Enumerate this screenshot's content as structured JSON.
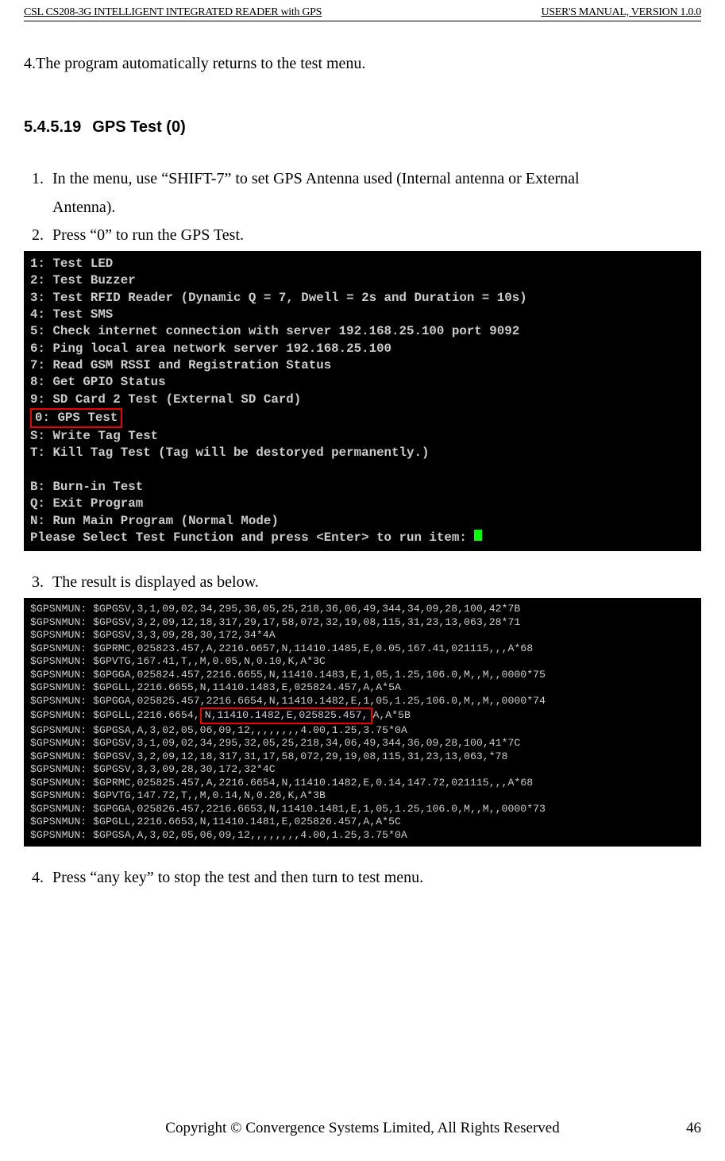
{
  "header": {
    "left": "CSL CS208-3G INTELLIGENT INTEGRATED READER with GPS",
    "right": "USER'S  MANUAL,  VERSION   1.0.0"
  },
  "topLine": "4.The program automatically returns to the test menu.",
  "section": {
    "num": "5.4.5.19",
    "title": "GPS Test (0)"
  },
  "steps": {
    "s1_a": "In  the  menu,  use  “SHIFT-7”  to  set  GPS  Antenna  used  (Internal  antenna  or  External",
    "s1_b": "Antenna).",
    "s2": "Press “0” to run the GPS Test.",
    "s3": "The result is displayed as below.",
    "s4": "Press “any key” to stop the test and then turn to test menu."
  },
  "term1": {
    "l1": "1: Test LED",
    "l2": "2: Test Buzzer",
    "l3": "3: Test RFID Reader (Dynamic Q = 7, Dwell = 2s and Duration = 10s)",
    "l4": "4: Test SMS",
    "l5": "5: Check internet connection with server 192.168.25.100 port 9092",
    "l6": "6: Ping local area network server 192.168.25.100",
    "l7": "7: Read GSM RSSI and Registration Status",
    "l8": "8: Get GPIO Status",
    "l9": "9: SD Card 2 Test (External SD Card)",
    "l10": "0: GPS Test",
    "l11": "S: Write Tag Test",
    "l12": "T: Kill Tag Test (Tag will be destoryed permanently.)",
    "l13": " ",
    "l14": "B: Burn-in Test",
    "l15": "Q: Exit Program",
    "l16": "N: Run Main Program (Normal Mode)",
    "l17": "Please Select Test Function and press <Enter> to run item: "
  },
  "term2": {
    "r1": "$GPSNMUN: $GPGSV,3,1,09,02,34,295,36,05,25,218,36,06,49,344,34,09,28,100,42*7B",
    "r2": "$GPSNMUN: $GPGSV,3,2,09,12,18,317,29,17,58,072,32,19,08,115,31,23,13,063,28*71",
    "r3": "$GPSNMUN: $GPGSV,3,3,09,28,30,172,34*4A",
    "r4": "$GPSNMUN: $GPRMC,025823.457,A,2216.6657,N,11410.1485,E,0.05,167.41,021115,,,A*68",
    "r5": "$GPSNMUN: $GPVTG,167.41,T,,M,0.05,N,0.10,K,A*3C",
    "r6": "$GPSNMUN: $GPGGA,025824.457,2216.6655,N,11410.1483,E,1,05,1.25,106.0,M,,M,,0000*75",
    "r7": "$GPSNMUN: $GPGLL,2216.6655,N,11410.1483,E,025824.457,A,A*5A",
    "r8": "$GPSNMUN: $GPGGA,025825.457,2216.6654,N,11410.1482,E,1,05,1.25,106.0,M,,M,,0000*74",
    "r9a": "$GPSNMUN: $GPGLL,2216.6654,",
    "r9h": "N,11410.1482,E,025825.457,",
    "r9b": "A,A*5B",
    "r10": "$GPSNMUN: $GPGSA,A,3,02,05,06,09,12,,,,,,,,4.00,1.25,3.75*0A",
    "r11": "$GPSNMUN: $GPGSV,3,1,09,02,34,295,32,05,25,218,34,06,49,344,36,09,28,100,41*7C",
    "r12": "$GPSNMUN: $GPGSV,3,2,09,12,18,317,31,17,58,072,29,19,08,115,31,23,13,063,*78",
    "r13": "$GPSNMUN: $GPGSV,3,3,09,28,30,172,32*4C",
    "r14": "$GPSNMUN: $GPRMC,025825.457,A,2216.6654,N,11410.1482,E,0.14,147.72,021115,,,A*68",
    "r15": "$GPSNMUN: $GPVTG,147.72,T,,M,0.14,N,0.26,K,A*3B",
    "r16": "$GPSNMUN: $GPGGA,025826.457,2216.6653,N,11410.1481,E,1,05,1.25,106.0,M,,M,,0000*73",
    "r17": "$GPSNMUN: $GPGLL,2216.6653,N,11410.1481,E,025826.457,A,A*5C",
    "r18": "$GPSNMUN: $GPGSA,A,3,02,05,06,09,12,,,,,,,,4.00,1.25,3.75*0A"
  },
  "footer": {
    "center": "Copyright © Convergence Systems Limited, All Rights Reserved",
    "page": "46"
  }
}
